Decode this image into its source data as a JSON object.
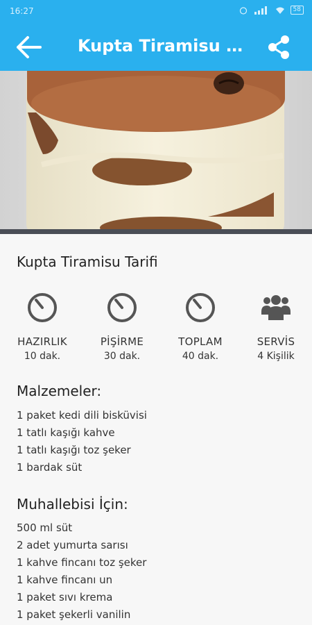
{
  "status": {
    "time": "16:27",
    "battery": "58"
  },
  "appbar": {
    "title": "Kupta Tiramisu Tarifi",
    "title_display": "Kupta Tiramisu T..."
  },
  "recipe": {
    "title": "Kupta Tiramisu Tarifi"
  },
  "stats": [
    {
      "icon": "timer-icon",
      "label": "HAZIRLIK",
      "value": "10 dak."
    },
    {
      "icon": "timer-icon",
      "label": "PİŞİRME",
      "value": "30 dak."
    },
    {
      "icon": "timer-icon",
      "label": "TOPLAM",
      "value": "40 dak."
    },
    {
      "icon": "people-icon",
      "label": "SERVİS",
      "value": "4 Kişilik"
    }
  ],
  "sections": [
    {
      "heading": "Malzemeler:",
      "items": [
        "1 paket kedi dili bisküvisi",
        "1 tatlı kaşığı kahve",
        "1 tatlı kaşığı toz şeker",
        "1 bardak süt"
      ]
    },
    {
      "heading": "Muhallebisi İçin:",
      "items": [
        "500 ml süt",
        "2 adet yumurta sarısı",
        "1 kahve fincanı toz şeker",
        "1 kahve fincanı un",
        "1 paket sıvı krema",
        "1 paket şekerli vanilin"
      ]
    }
  ],
  "colors": {
    "accent": "#2ab0ee",
    "icon": "#555555"
  }
}
